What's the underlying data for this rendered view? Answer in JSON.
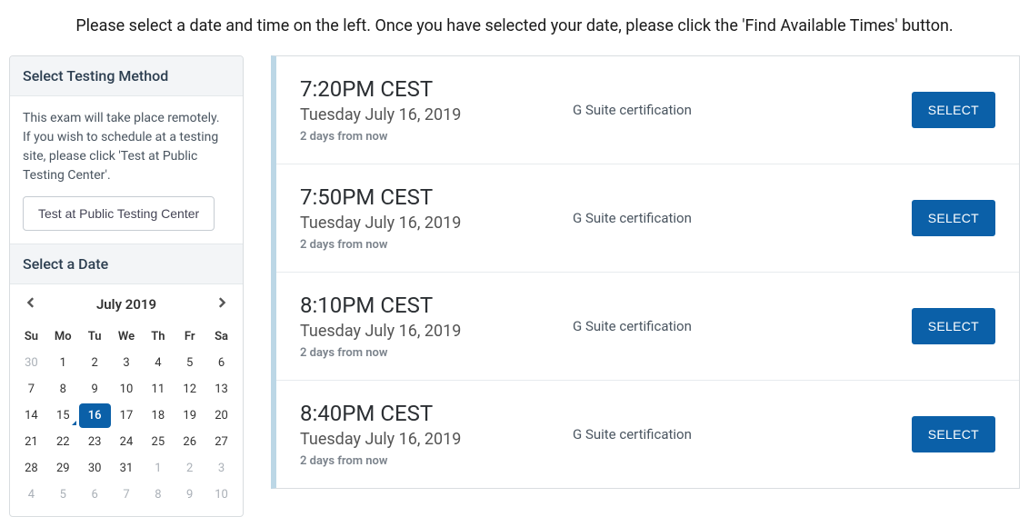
{
  "instruction": "Please select a date and time on the left. Once you have selected your date, please click the 'Find Available Times' button.",
  "sidebar": {
    "method_header": "Select Testing Method",
    "method_desc": "This exam will take place remotely. If you wish to schedule at a testing site, please click 'Test at Public Testing Center'.",
    "test_center_btn": "Test at Public Testing Center",
    "date_header": "Select a Date",
    "calendar": {
      "month_label": "July 2019",
      "dow": [
        "Su",
        "Mo",
        "Tu",
        "We",
        "Th",
        "Fr",
        "Sa"
      ],
      "weeks": [
        [
          {
            "d": "30",
            "out": true
          },
          {
            "d": "1"
          },
          {
            "d": "2"
          },
          {
            "d": "3"
          },
          {
            "d": "4"
          },
          {
            "d": "5"
          },
          {
            "d": "6"
          }
        ],
        [
          {
            "d": "7"
          },
          {
            "d": "8"
          },
          {
            "d": "9"
          },
          {
            "d": "10"
          },
          {
            "d": "11"
          },
          {
            "d": "12"
          },
          {
            "d": "13"
          }
        ],
        [
          {
            "d": "14"
          },
          {
            "d": "15",
            "today": true
          },
          {
            "d": "16",
            "selected": true
          },
          {
            "d": "17"
          },
          {
            "d": "18"
          },
          {
            "d": "19"
          },
          {
            "d": "20"
          }
        ],
        [
          {
            "d": "21"
          },
          {
            "d": "22"
          },
          {
            "d": "23"
          },
          {
            "d": "24"
          },
          {
            "d": "25"
          },
          {
            "d": "26"
          },
          {
            "d": "27"
          }
        ],
        [
          {
            "d": "28"
          },
          {
            "d": "29"
          },
          {
            "d": "30"
          },
          {
            "d": "31"
          },
          {
            "d": "1",
            "out": true
          },
          {
            "d": "2",
            "out": true
          },
          {
            "d": "3",
            "out": true
          }
        ],
        [
          {
            "d": "4",
            "out": true
          },
          {
            "d": "5",
            "out": true
          },
          {
            "d": "6",
            "out": true
          },
          {
            "d": "7",
            "out": true
          },
          {
            "d": "8",
            "out": true
          },
          {
            "d": "9",
            "out": true
          },
          {
            "d": "10",
            "out": true
          }
        ]
      ]
    }
  },
  "slots": [
    {
      "time": "7:20PM CEST",
      "date": "Tuesday July 16, 2019",
      "rel": "2 days from now",
      "desc": "G Suite certification",
      "btn": "SELECT"
    },
    {
      "time": "7:50PM CEST",
      "date": "Tuesday July 16, 2019",
      "rel": "2 days from now",
      "desc": "G Suite certification",
      "btn": "SELECT"
    },
    {
      "time": "8:10PM CEST",
      "date": "Tuesday July 16, 2019",
      "rel": "2 days from now",
      "desc": "G Suite certification",
      "btn": "SELECT"
    },
    {
      "time": "8:40PM CEST",
      "date": "Tuesday July 16, 2019",
      "rel": "2 days from now",
      "desc": "G Suite certification",
      "btn": "SELECT"
    }
  ]
}
